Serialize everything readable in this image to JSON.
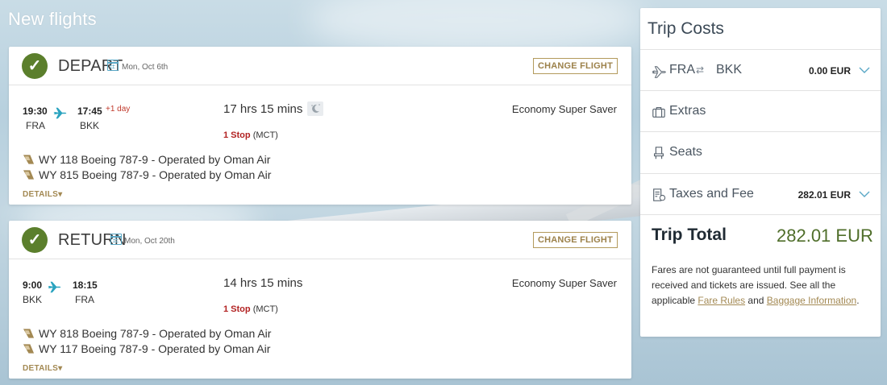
{
  "page": {
    "title": "New flights"
  },
  "depart": {
    "heading": "DEPART",
    "date": "Mon, Oct 6th",
    "change_label": "CHANGE FLIGHT",
    "dep_time": "19:30",
    "arr_time": "17:45",
    "plus_day": "+1 day",
    "from": "FRA",
    "to": "BKK",
    "duration": "17 hrs 15 mins",
    "stops": "1 Stop",
    "via": "(MCT)",
    "cabin": "Economy Super Saver",
    "segments": [
      {
        "label": "WY 118 Boeing 787-9 - Operated by Oman Air"
      },
      {
        "label": "WY 815 Boeing 787-9 - Operated by Oman Air"
      }
    ],
    "details_label": "DETAILS"
  },
  "return": {
    "heading": "RETURN",
    "date": "Mon, Oct 20th",
    "change_label": "CHANGE FLIGHT",
    "dep_time": "9:00",
    "arr_time": "18:15",
    "from": "BKK",
    "to": "FRA",
    "duration": "14 hrs 15 mins",
    "stops": "1 Stop",
    "via": "(MCT)",
    "cabin": "Economy Super Saver",
    "segments": [
      {
        "label": "WY 818 Boeing 787-9 - Operated by Oman Air"
      },
      {
        "label": "WY 117 Boeing 787-9 - Operated by Oman Air"
      }
    ],
    "details_label": "DETAILS"
  },
  "costs": {
    "title": "Trip Costs",
    "route": {
      "from": "FRA",
      "to": "BKK",
      "amount": "0.00 EUR"
    },
    "extras_label": "Extras",
    "seats_label": "Seats",
    "taxes": {
      "label": "Taxes and Fee",
      "amount": "282.01 EUR"
    },
    "total_label": "Trip Total",
    "total_amount": "282.01 EUR",
    "note_part1": "Fares are not guaranteed until full payment is received and tickets are issued. See all the applicable ",
    "fare_rules_link": "Fare Rules",
    "note_and": " and ",
    "baggage_link": "Baggage Information",
    "note_end": "."
  },
  "colors": {
    "accent_gold": "#a38953",
    "check_green": "#5b7f2c",
    "total_green": "#4f6e2a",
    "stop_red": "#b22222",
    "plane_teal": "#2aa3bf"
  },
  "icons": [
    "check-icon",
    "calendar-icon",
    "airplane-icon",
    "night-icon",
    "tail-logo-icon",
    "caret-down-icon",
    "suitcase-icon",
    "seat-icon",
    "receipt-icon",
    "chevron-down-icon",
    "swap-icon"
  ]
}
